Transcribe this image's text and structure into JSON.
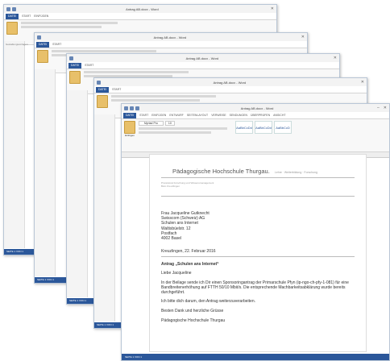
{
  "window": {
    "doc_title": "Antrag AB.docx - Word",
    "font_name": "Myriad Pro",
    "font_size": "10",
    "tabs": [
      "DATEI",
      "START",
      "EINFÜGEN",
      "ENTWURF",
      "SEITENLAYOUT",
      "VERWEISE",
      "SENDUNGEN",
      "ÜBERPRÜFEN",
      "ANSICHT",
      "ENTWICKLERTOOLS",
      "ADD-INS",
      "OFFICE",
      "Zeta",
      "ENTWURF",
      "LAYOUT"
    ],
    "paste_label": "Einfügen",
    "style_samples": [
      "AaBbCcDd",
      "AaBbCcDd",
      "AaBbCcD"
    ],
    "style_names": [
      "Standard",
      "Kein Lee...",
      "Überschrift 1"
    ],
    "status_text": "SEITE 1 VON 1",
    "sidebar_label": "Gestaltungsvorlagen"
  },
  "document": {
    "org_name": "Pädagogische Hochschule Thurgau.",
    "org_sub": "Lehre · Weiterbildung · Forschung",
    "small_lines": [
      "Prorektorat Forschung und Wissensmanagement",
      "Büro Kreuzlingen"
    ],
    "address": [
      "Frau Jacqueline Gutknecht",
      "Swisscom (Schweiz) AG",
      "Schulen ans Internet",
      "Waltisbüelstr. 12",
      "Postfach",
      "4002 Basel"
    ],
    "date_line": "Kreuzlingen, 22. Februar 2016",
    "subject": "Antrag „Schulen ans Internet“",
    "salutation": "Liebe Jacqueline",
    "paragraph1": "In der Beilage sende ich Dir einen Sponsoringantrag der Primarschule Pfyn (ip-ngo-ch-pfy-1-081) für eine Bandbreitenerhöhung auf FTTH 50/10 Mbit/s. Die entsprechende Machbarkeitsabklärung wurde bereits durchgeführt.",
    "paragraph2": "Ich bitte dich darum, den Antrag weiterzuverarbeiten.",
    "closing": "Besten Dank und herzliche Grüsse",
    "signature": "Pädagogische Hochschule Thurgau"
  }
}
